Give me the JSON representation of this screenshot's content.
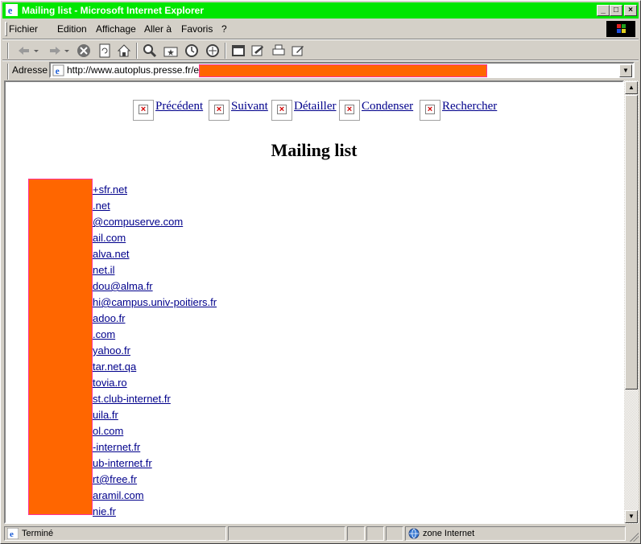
{
  "window": {
    "title": "Mailing list - Microsoft Internet Explorer"
  },
  "menu": [
    "Fichier",
    "Edition",
    "Affichage",
    "Aller à",
    "Favoris",
    "?"
  ],
  "address": {
    "label": "Adresse",
    "url": "http://www.autoplus.presse.fr/ema"
  },
  "nav": [
    "Précédent",
    "Suivant",
    "Détailler",
    "Condenser",
    "Rechercher"
  ],
  "page": {
    "title": "Mailing list",
    "emails": [
      "+sfr.net",
      ".net",
      "@compuserve.com",
      "ail.com",
      "alva.net",
      "net.il",
      "dou@alma.fr",
      "hi@campus.univ-poitiers.fr",
      "adoo.fr",
      ".com",
      "yahoo.fr",
      "tar.net.qa",
      "tovia.ro",
      "st.club-internet.fr",
      "uila.fr",
      "ol.com",
      "-internet.fr",
      "ub-internet.fr",
      "rt@free.fr",
      "aramil.com",
      "nie.fr"
    ]
  },
  "status": {
    "text": "Terminé",
    "zone": "zone Internet"
  },
  "colors": {
    "titlebar": "#00e600",
    "redaction": "#ff6600",
    "link": "#00008b"
  }
}
